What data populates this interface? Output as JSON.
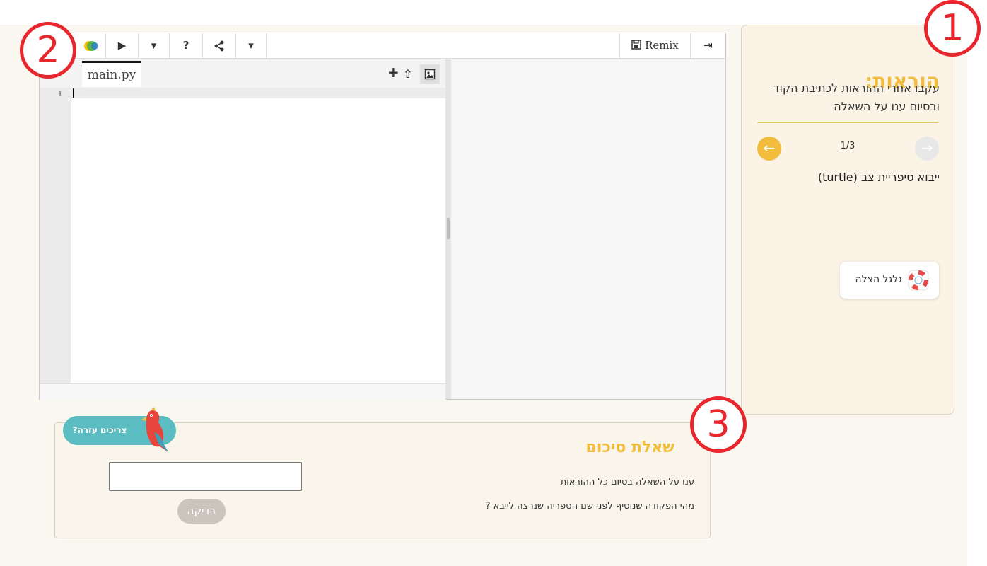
{
  "instructions": {
    "title": "הוראות:",
    "description": "עקבו אחרי ההוראות לכתיבת הקוד ובסיום ענו על השאלה",
    "step_counter": "1/3",
    "step_text": "ייבוא סיפריית צב (turtle)",
    "prev_arrow": "←",
    "next_arrow": "→",
    "lifebuoy_label": "גלגל הצלה"
  },
  "editor": {
    "toolbar": {
      "run": "▶",
      "dropdown": "▾",
      "help": "?",
      "share": "⋖",
      "dropdown2": "▾",
      "remix": "Remix",
      "login": "⇥"
    },
    "tab_label": "main.py",
    "file_actions": {
      "add": "+",
      "upload": "⇧",
      "image": "▣"
    },
    "line_number": "1"
  },
  "summary": {
    "title": "שאלת סיכום",
    "line1": "ענו על השאלה בסיום כל ההוראות",
    "line2": "מהי הפקודה שנוסיף לפני שם הספריה שנרצה לייבא ?",
    "answer_value": "",
    "check_label": "בדיקה",
    "help_label": "צריכים עזרה?"
  },
  "markers": [
    "1",
    "2",
    "3"
  ],
  "colors": {
    "accent": "#f2bd3c",
    "marker": "#e8262d",
    "help": "#5bbdc1"
  }
}
